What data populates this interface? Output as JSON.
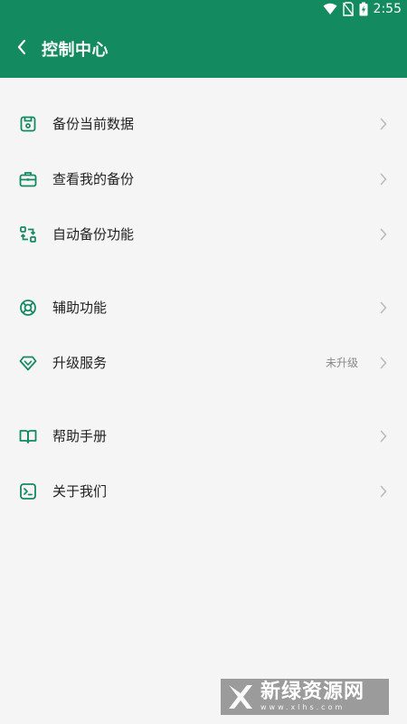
{
  "status_bar": {
    "time": "2:55",
    "icons": [
      "wifi-icon",
      "no-sim-icon",
      "battery-charging-icon"
    ]
  },
  "header": {
    "title": "控制中心",
    "back_icon": "chevron-left-icon",
    "background": "#138a60"
  },
  "menu": {
    "groups": [
      {
        "items": [
          {
            "label": "备份当前数据",
            "icon": "save-icon"
          },
          {
            "label": "查看我的备份",
            "icon": "briefcase-icon"
          },
          {
            "label": "自动备份功能",
            "icon": "sync-icon"
          }
        ]
      },
      {
        "items": [
          {
            "label": "辅助功能",
            "icon": "lifebuoy-icon"
          },
          {
            "label": "升级服务",
            "icon": "diamond-icon",
            "value": "未升级"
          }
        ]
      },
      {
        "items": [
          {
            "label": "帮助手册",
            "icon": "book-icon"
          },
          {
            "label": "关于我们",
            "icon": "terminal-icon"
          }
        ]
      }
    ]
  },
  "watermark": {
    "title": "新绿资源网",
    "url": "www.xlhs.com"
  },
  "colors": {
    "accent": "#138a60",
    "text": "#222222",
    "secondary_text": "#888888",
    "background": "#f5f5f5"
  }
}
